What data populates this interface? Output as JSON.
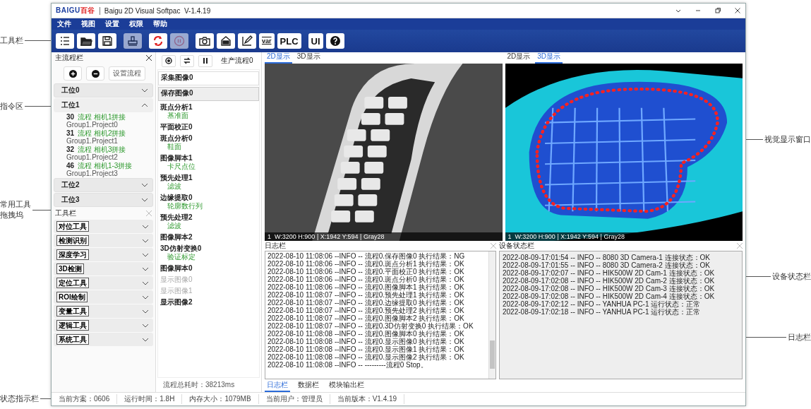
{
  "callouts": {
    "left": [
      {
        "lines": [
          "工具栏"
        ]
      },
      {
        "lines": [
          "指令区"
        ]
      },
      {
        "lines": [
          "常用工具",
          "拖拽坞"
        ]
      },
      {
        "lines": [
          "状态指示栏"
        ]
      }
    ],
    "right": [
      {
        "lines": [
          "视觉显示窗口"
        ]
      },
      {
        "lines": [
          "设备状态栏"
        ]
      },
      {
        "lines": [
          "日志栏"
        ]
      }
    ]
  },
  "window": {
    "logo": "BAIGU",
    "logo_cn": "百谷",
    "title": "Baigu 2D Visual Softpac  V-1.4.19"
  },
  "menu": [
    "文件",
    "视图",
    "设置",
    "权限",
    "帮助"
  ],
  "toolbar": {
    "groups": [
      [
        {
          "kind": "list",
          "disabled": false
        },
        {
          "kind": "folder",
          "disabled": false
        },
        {
          "kind": "save",
          "disabled": false
        }
      ],
      [
        {
          "kind": "stamp",
          "disabled": true
        }
      ],
      [
        {
          "kind": "sync",
          "disabled": false
        },
        {
          "kind": "stop",
          "disabled": true
        }
      ],
      [
        {
          "kind": "camera",
          "disabled": false
        },
        {
          "kind": "device",
          "disabled": false
        },
        {
          "kind": "edit",
          "disabled": false
        },
        {
          "kind": "text",
          "label": "var",
          "disabled": false
        },
        {
          "kind": "text",
          "label": "PLC",
          "disabled": false
        }
      ],
      [
        {
          "kind": "text",
          "label": "UI",
          "disabled": false
        },
        {
          "kind": "help",
          "disabled": false
        }
      ]
    ]
  },
  "flow_panel": {
    "title": "主流程栏",
    "buttons": [
      {
        "kind": "add"
      },
      {
        "kind": "remove"
      },
      {
        "kind": "text",
        "label": "设置流程"
      }
    ],
    "stations": [
      {
        "label": "工位0",
        "expanded": false
      },
      {
        "label": "工位1",
        "expanded": true,
        "items": [
          {
            "number": "30",
            "name": "流程 相机1拼接",
            "project": "Group1.Project0"
          },
          {
            "number": "31",
            "name": "流程 相机2拼接",
            "project": "Group1.Project1"
          },
          {
            "number": "32",
            "name": "流程 相机3拼接",
            "project": "Group1.Project2"
          },
          {
            "number": "46",
            "name": "流程 相机1-3拼接",
            "project": "Group1.Project3"
          }
        ]
      },
      {
        "label": "工位2",
        "expanded": false
      },
      {
        "label": "工位3",
        "expanded": false
      }
    ]
  },
  "toolbox": {
    "title": "工具栏",
    "groups": [
      "对位工具",
      "检测识别",
      "深度学习",
      "3D检测",
      "定位工具",
      "ROI绘制",
      "变量工具",
      "逻辑工具",
      "系统工具"
    ]
  },
  "process": {
    "title": "生产流程0",
    "steps": [
      {
        "name": "采集图像0",
        "framed": true,
        "selected": false,
        "disabled": false
      },
      {
        "name": "保存图像0",
        "framed": true,
        "selected": true,
        "disabled": false
      },
      {
        "name": "斑点分析1",
        "note": "基准面",
        "framed": false,
        "selected": false,
        "disabled": false
      },
      {
        "name": "平面校正0",
        "framed": false,
        "selected": false,
        "disabled": false
      },
      {
        "name": "斑点分析0",
        "note": "鞋面",
        "framed": false,
        "selected": false,
        "disabled": false
      },
      {
        "name": "图像脚本1",
        "note": "卡尺点位",
        "framed": false,
        "selected": false,
        "disabled": false
      },
      {
        "name": "预先处理1",
        "note": "滤波",
        "framed": false,
        "selected": false,
        "disabled": false
      },
      {
        "name": "边缘提取0",
        "note": "轮廓数行列",
        "framed": false,
        "selected": false,
        "disabled": false
      },
      {
        "name": "预先处理2",
        "note": "滤波",
        "framed": false,
        "selected": false,
        "disabled": false
      },
      {
        "name": "图像脚本2",
        "framed": false,
        "selected": false,
        "disabled": false
      },
      {
        "name": "3D仿射变换0",
        "note": "验证标定",
        "framed": false,
        "selected": false,
        "disabled": false
      },
      {
        "name": "图像脚本0",
        "framed": false,
        "selected": false,
        "disabled": false
      },
      {
        "name": "显示图像0",
        "framed": false,
        "selected": false,
        "disabled": true
      },
      {
        "name": "显示图像1",
        "framed": false,
        "selected": false,
        "disabled": true
      },
      {
        "name": "显示图像2",
        "framed": false,
        "selected": false,
        "disabled": false
      }
    ],
    "total_time": "流程总耗时：38213ms"
  },
  "displays": [
    {
      "kind": "photo",
      "tabs": [
        {
          "label": "2D显示",
          "selected": true
        },
        {
          "label": "3D显示",
          "selected": false
        }
      ],
      "info": "1  W:3200 H:900 | X:1942 Y:594 | Gray28"
    },
    {
      "kind": "point_cloud",
      "tabs": [
        {
          "label": "2D显示",
          "selected": false
        },
        {
          "label": "3D显示",
          "selected": true
        }
      ],
      "info": "1  W:3200 H:900 | X:1942 Y:594 | Gray28"
    }
  ],
  "log": {
    "title": "日志栏",
    "lines": [
      "2022-08-10 11:08:06 --INFO -- 流程0.保存图像0 执行结果：NG",
      "2022-08-10 11:08:06 --INFO -- 流程0.斑点分析1 执行结果：OK",
      "2022-08-10 11:08:06 --INFO -- 流程0.平面校正0 执行结果：OK",
      "2022-08-10 11:08:06 --INFO -- 流程0.斑点分析0 执行结果：OK",
      "2022-08-10 11:08:06 --INFO -- 流程0.图像脚本1 执行结果：OK",
      "2022-08-10 11:08:07 --INFO -- 流程0.预先处理1 执行结果：OK",
      "2022-08-10 11:08:07 --INFO -- 流程0.边缘提取0 执行结果：OK",
      "2022-08-10 11:08:07 --INFO -- 流程0.预先处理2 执行结果：OK",
      "2022-08-10 11:08:07 --INFO -- 流程0.图像脚本2 执行结果：OK",
      "2022-08-10 11:08:07 --INFO -- 流程0.3D仿射变换0 执行结果：OK",
      "2022-08-10 11:08:08 --INFO -- 流程0.图像脚本0 执行结果：OK",
      "2022-08-10 11:08:08 --INFO -- 流程0.显示图像0 执行结果：OK",
      "2022-08-10 11:08:08 --INFO -- 流程0.显示图像1 执行结果：OK",
      "2022-08-10 11:08:08 --INFO -- 流程0.显示图像2 执行结果：OK",
      "2022-08-10 11:08:08 --INFO -- ---------流程0 Stop。"
    ],
    "tabs": [
      {
        "label": "日志栏",
        "selected": true
      },
      {
        "label": "数据栏",
        "selected": false
      },
      {
        "label": "模块输出栏",
        "selected": false
      }
    ]
  },
  "device_status": {
    "title": "设备状态栏",
    "lines": [
      "2022-08-09-17:01:54 -- INFO -- 8080 3D Camera-1 连接状态：OK",
      "2022-08-09-17:01:55 -- INFO -- 8080 3D Camera-2 连接状态：OK",
      "2022-08-09-17:02:07 -- INFO -- HIK500W 2D Cam-1 连接状态：OK",
      "2022-08-09-17:02:08 -- INFO -- HIK500W 2D Cam-2 连接状态：OK",
      "2022-08-09-17:02:08 -- INFO -- HIK500W 2D Cam-3 连接状态：OK",
      "2022-08-09-17:02:08 -- INFO -- HIK500W 2D Cam-4 连接状态：OK",
      "2022-08-09-17:02:12 -- INFO -- YANHUA PC-1 运行状态：正常",
      "2022-08-09-17:02:18 -- INFO -- YANHUA PC-1 运行状态：正常"
    ]
  },
  "status_bar": [
    "当前方案：0606",
    "运行时间：1.8H",
    "内存大小：1079MB",
    "当前用户：管理员",
    "当前版本：V1.4.19"
  ]
}
